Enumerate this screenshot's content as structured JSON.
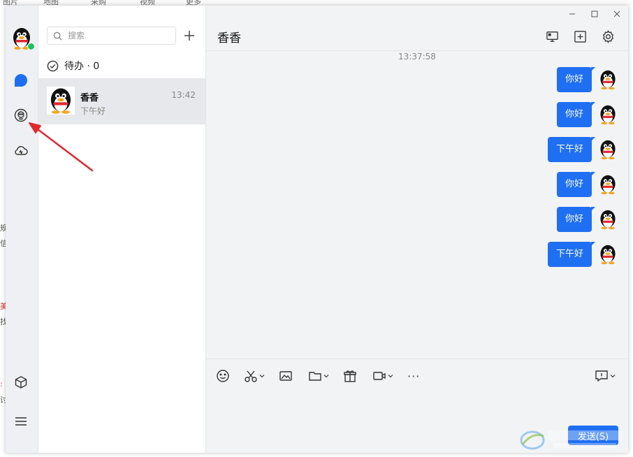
{
  "background": {
    "top_labels": [
      "图片",
      "地图",
      "采购",
      "视频",
      "更多"
    ],
    "left_fragments": [
      "规",
      "信",
      "美",
      "找",
      ":",
      "讨"
    ]
  },
  "rail": {
    "items": [
      "avatar",
      "chat-icon",
      "contacts-icon",
      "cloud-icon"
    ],
    "bottom": [
      "box-icon",
      "menu-icon"
    ],
    "online_color": "#20c05c"
  },
  "search": {
    "placeholder": "搜索"
  },
  "todo": {
    "label": "待办 · 0"
  },
  "conversations": [
    {
      "name": "香香",
      "preview": "下午好",
      "time": "13:42"
    }
  ],
  "chat": {
    "title": "香香",
    "timestamp": "13:37:58",
    "messages": [
      "你好",
      "你好",
      "下午好",
      "你好",
      "你好",
      "下午好"
    ]
  },
  "toolbar": {
    "icons": [
      "emoji-icon",
      "scissors-icon",
      "image-icon",
      "folder-icon",
      "gift-icon",
      "video-icon",
      "more-icon",
      "feedback-icon"
    ],
    "more_label": "···",
    "send_label": "发送(S)"
  },
  "colors": {
    "accent": "#1f6ff2",
    "arrow": "#e0282e"
  }
}
